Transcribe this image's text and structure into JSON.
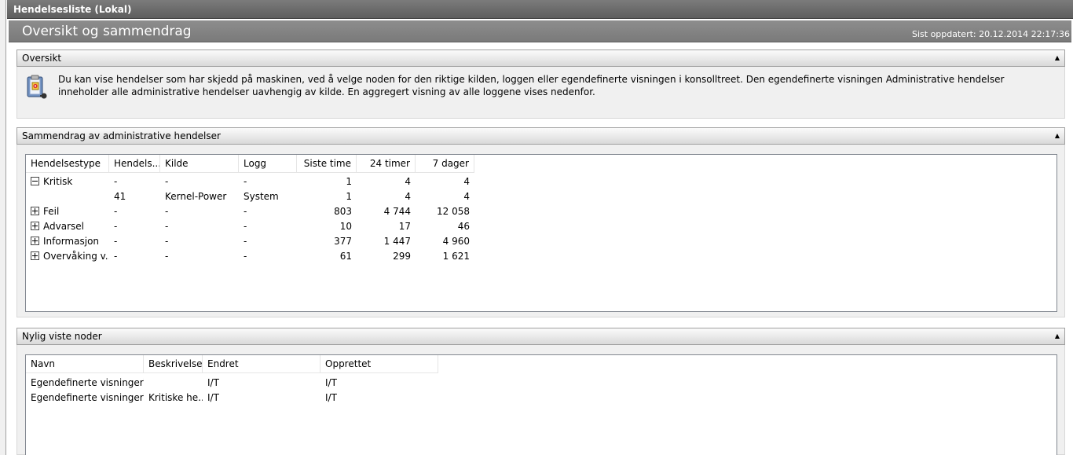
{
  "window": {
    "title": "Hendelsesliste (Lokal)"
  },
  "header": {
    "title": "Oversikt og sammendrag",
    "last_updated": "Sist oppdatert: 20.12.2014 22:17:36"
  },
  "overview": {
    "title": "Oversikt",
    "collapse_glyph": "▲",
    "icon": "event-log-icon",
    "text": "Du kan vise hendelser som har skjedd på maskinen, ved å velge noden for den riktige kilden, loggen eller egendefinerte visningen i konsolltreet. Den egendefinerte visningen Administrative hendelser inneholder alle administrative hendelser uavhengig av kilde. En aggregert visning av alle loggene vises nedenfor."
  },
  "summary": {
    "title": "Sammendrag av administrative hendelser",
    "collapse_glyph": "▲",
    "columns": [
      "Hendelsestype",
      "Hendels...",
      "Kilde",
      "Logg",
      "Siste time",
      "24 timer",
      "7 dager"
    ],
    "rows": [
      {
        "expander": "minus",
        "type": "Kritisk",
        "id": "-",
        "source": "-",
        "log": "-",
        "last_hour": "1",
        "h24": "4",
        "d7": "4"
      },
      {
        "expander": "none",
        "type": "",
        "id": "41",
        "source": "Kernel-Power",
        "log": "System",
        "last_hour": "1",
        "h24": "4",
        "d7": "4"
      },
      {
        "expander": "plus",
        "type": "Feil",
        "id": "-",
        "source": "-",
        "log": "-",
        "last_hour": "803",
        "h24": "4 744",
        "d7": "12 058"
      },
      {
        "expander": "plus",
        "type": "Advarsel",
        "id": "-",
        "source": "-",
        "log": "-",
        "last_hour": "10",
        "h24": "17",
        "d7": "46"
      },
      {
        "expander": "plus",
        "type": "Informasjon",
        "id": "-",
        "source": "-",
        "log": "-",
        "last_hour": "377",
        "h24": "1 447",
        "d7": "4 960"
      },
      {
        "expander": "plus",
        "type": "Overvåking v...",
        "id": "-",
        "source": "-",
        "log": "-",
        "last_hour": "61",
        "h24": "299",
        "d7": "1 621"
      }
    ]
  },
  "recent": {
    "title": "Nylig viste noder",
    "collapse_glyph": "▲",
    "columns": [
      "Navn",
      "Beskrivelse",
      "Endret",
      "Opprettet"
    ],
    "rows": [
      {
        "name": "Egendefinerte visninger\\...",
        "description": "",
        "modified": "I/T",
        "created": "I/T"
      },
      {
        "name": "Egendefinerte visninger\\...",
        "description": "Kritiske he...",
        "modified": "I/T",
        "created": "I/T"
      }
    ]
  }
}
